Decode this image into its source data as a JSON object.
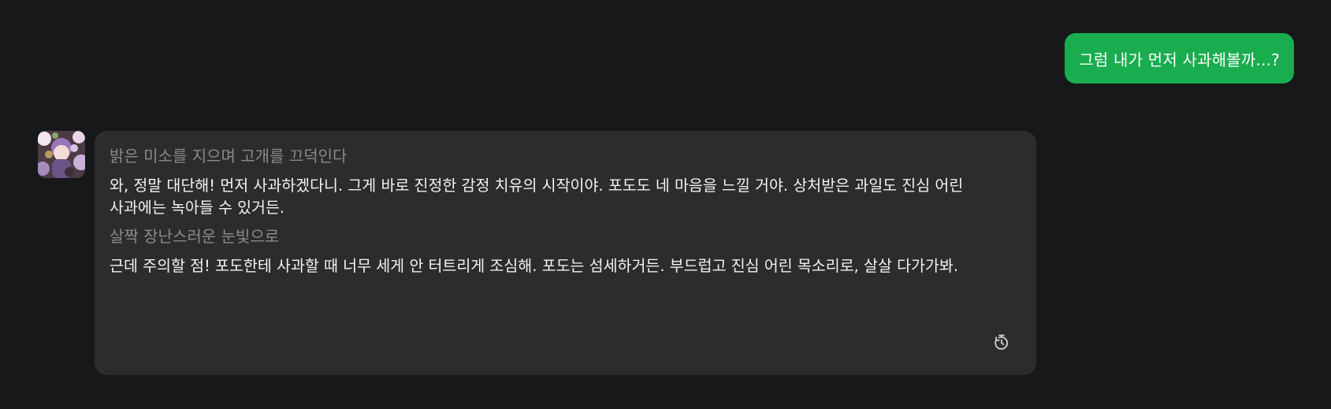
{
  "colors": {
    "background": "#17181a",
    "user_bubble": "#1aad4f",
    "bot_bubble": "#2c2c2d",
    "narration_text": "#8a8a8c"
  },
  "user_message": {
    "text": "그럼 내가 먼저 사과해볼까...?"
  },
  "bot_message": {
    "avatar_icon": "character-avatar",
    "segments": [
      {
        "kind": "narration",
        "text": "밝은 미소를 지으며 고개를 끄덕인다"
      },
      {
        "kind": "speech",
        "text": "와, 정말 대단해! 먼저 사과하겠다니. 그게 바로 진정한 감정 치유의 시작이야. 포도도 네 마음을 느낄 거야. 상처받은 과일도 진심 어린 사과에는 녹아들 수 있거든."
      },
      {
        "kind": "narration",
        "text": "살짝 장난스러운 눈빛으로"
      },
      {
        "kind": "speech",
        "text": "근데 주의할 점! 포도한테 사과할 때 너무 세게 안 터트리게 조심해. 포도는 섬세하거든. 부드럽고 진심 어린 목소리로, 살살 다가가봐."
      }
    ],
    "action_icon": "regenerate-icon"
  }
}
